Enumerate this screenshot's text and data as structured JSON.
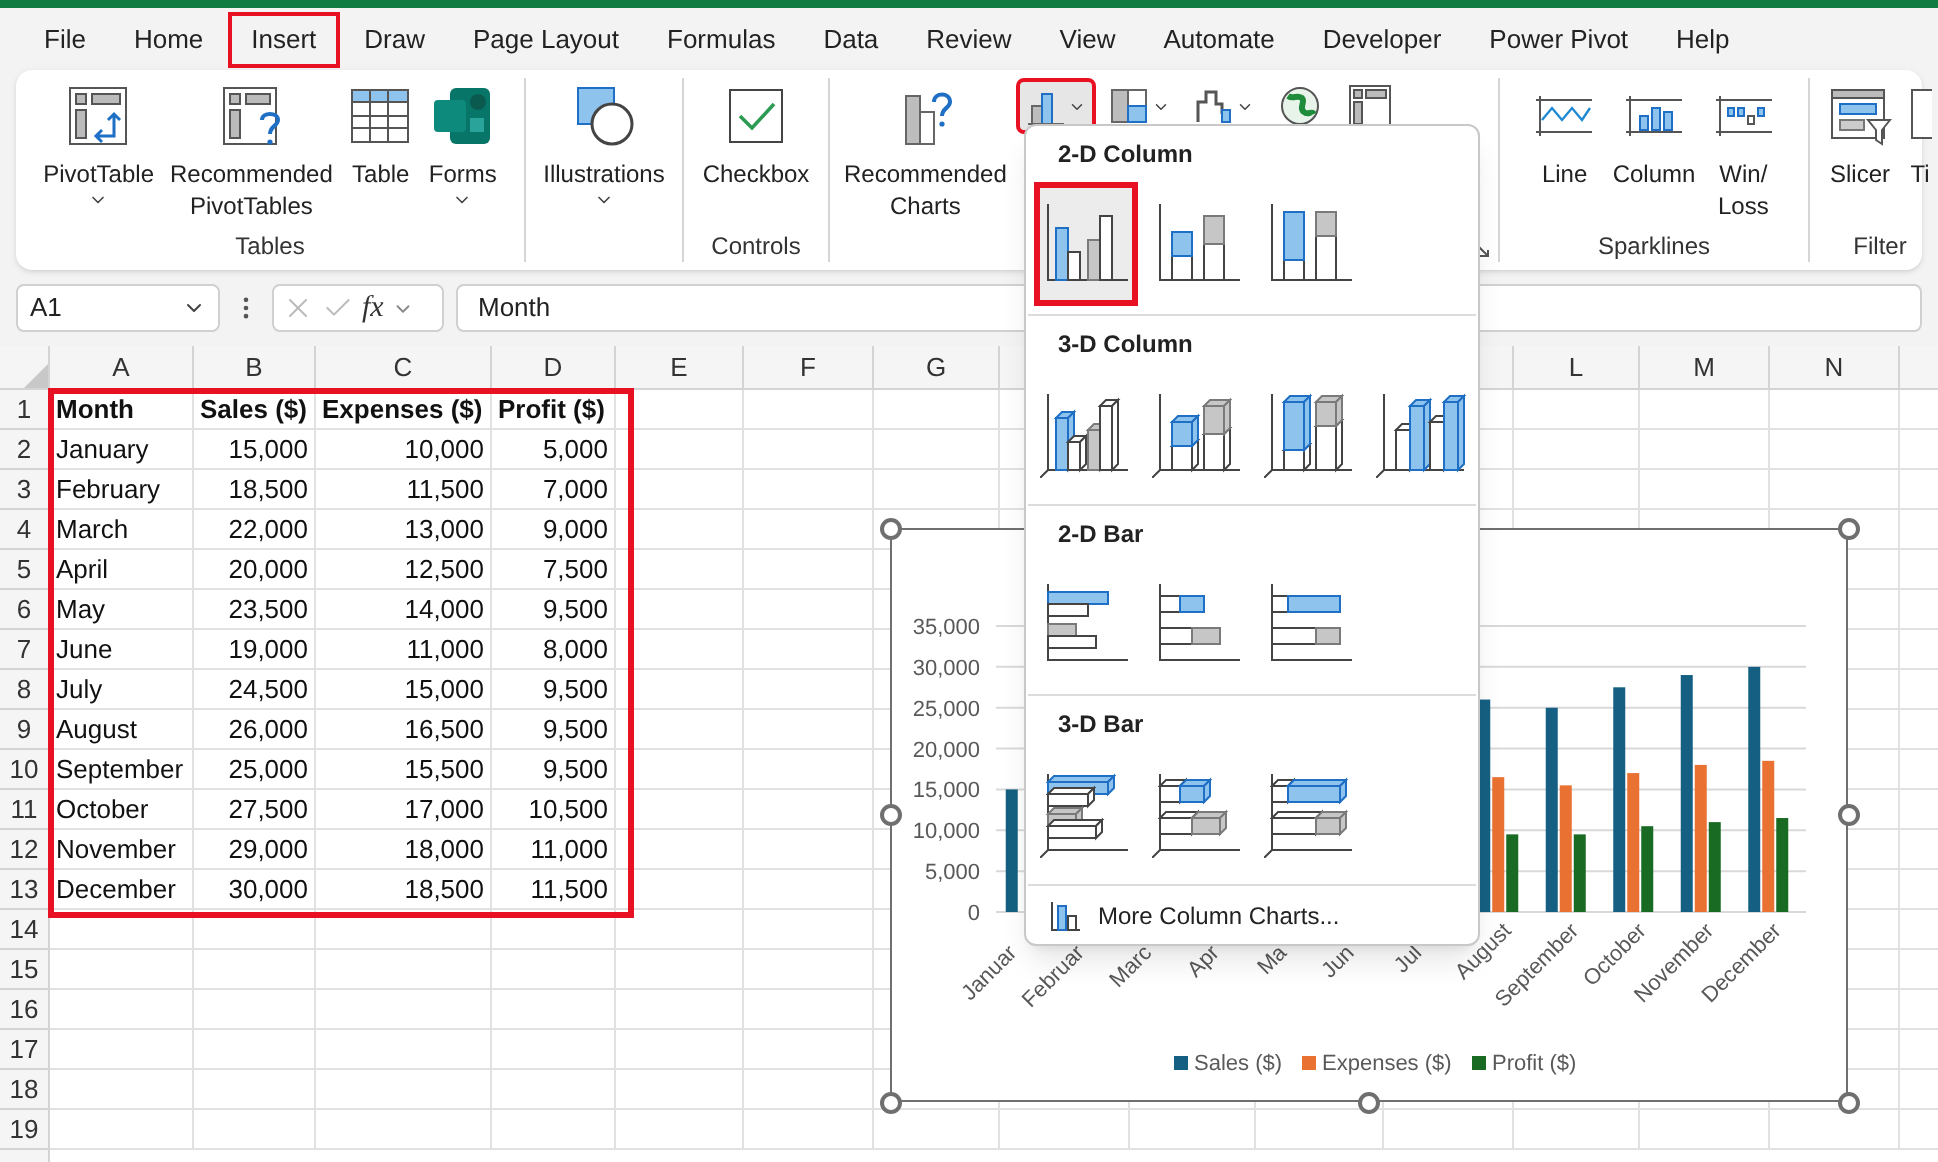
{
  "tabs": [
    {
      "label": "File",
      "highlighted": false
    },
    {
      "label": "Home",
      "highlighted": false
    },
    {
      "label": "Insert",
      "highlighted": true
    },
    {
      "label": "Draw",
      "highlighted": false
    },
    {
      "label": "Page Layout",
      "highlighted": false
    },
    {
      "label": "Formulas",
      "highlighted": false
    },
    {
      "label": "Data",
      "highlighted": false
    },
    {
      "label": "Review",
      "highlighted": false
    },
    {
      "label": "View",
      "highlighted": false
    },
    {
      "label": "Automate",
      "highlighted": false
    },
    {
      "label": "Developer",
      "highlighted": false
    },
    {
      "label": "Power Pivot",
      "highlighted": false
    },
    {
      "label": "Help",
      "highlighted": false
    }
  ],
  "ribbon": {
    "groups": [
      {
        "label": "Tables",
        "items": [
          {
            "kind": "large",
            "lines": [
              "PivotTable"
            ],
            "caret": true
          },
          {
            "kind": "large",
            "lines": [
              "Recommended",
              "PivotTables"
            ],
            "caret": false
          },
          {
            "kind": "large",
            "lines": [
              "Table"
            ],
            "caret": false
          },
          {
            "kind": "large",
            "lines": [
              "Forms"
            ],
            "caret": true
          }
        ]
      },
      {
        "items": [
          {
            "kind": "large",
            "lines": [
              "Illustrations"
            ],
            "caret": true
          }
        ]
      },
      {
        "label": "Controls",
        "items": [
          {
            "kind": "large",
            "lines": [
              "Checkbox"
            ],
            "caret": false
          }
        ]
      },
      {
        "launcher": true,
        "items": [
          {
            "kind": "large",
            "lines": [
              "Recommended",
              "Charts"
            ],
            "caret": false
          },
          {
            "kind": "small",
            "caret": true,
            "highlighted": true
          },
          {
            "kind": "small",
            "caret": true,
            "highlighted": false
          },
          {
            "kind": "small",
            "caret": true,
            "highlighted": false
          },
          {
            "kind": "small",
            "caret": false,
            "highlighted": false
          },
          {
            "kind": "small",
            "caret": false,
            "highlighted": false
          }
        ]
      },
      {
        "label": "Sparklines",
        "items": [
          {
            "kind": "large",
            "lines": [
              "Line"
            ],
            "caret": false
          },
          {
            "kind": "large",
            "lines": [
              "Column"
            ],
            "caret": false
          },
          {
            "kind": "large",
            "lines": [
              "Win/",
              "Loss"
            ],
            "caret": false
          }
        ]
      },
      {
        "label": "Filter",
        "items": [
          {
            "kind": "large",
            "lines": [
              "Slicer"
            ],
            "caret": false
          },
          {
            "kind": "large",
            "lines": [
              "Ti"
            ],
            "caret": false
          }
        ]
      }
    ]
  },
  "formula_bar": {
    "name_box": "A1",
    "function_label": "fx",
    "value": "Month"
  },
  "sheet": {
    "columns": [
      "A",
      "B",
      "C",
      "D",
      "E",
      "F",
      "G",
      "L",
      "M",
      "N"
    ],
    "rows": [
      "1",
      "2",
      "3",
      "4",
      "5",
      "6",
      "7",
      "8",
      "9",
      "10",
      "11",
      "12",
      "13",
      "14",
      "15",
      "16",
      "17",
      "18",
      "19"
    ]
  },
  "table": {
    "highlighted": true,
    "header": [
      "Month",
      "Sales ($)",
      "Expenses ($)",
      "Profit ($)"
    ],
    "rows": [
      [
        "January",
        "15,000",
        "10,000",
        "5,000"
      ],
      [
        "February",
        "18,500",
        "11,500",
        "7,000"
      ],
      [
        "March",
        "22,000",
        "13,000",
        "9,000"
      ],
      [
        "April",
        "20,000",
        "12,500",
        "7,500"
      ],
      [
        "May",
        "23,500",
        "14,000",
        "9,500"
      ],
      [
        "June",
        "19,000",
        "11,000",
        "8,000"
      ],
      [
        "July",
        "24,500",
        "15,000",
        "9,500"
      ],
      [
        "August",
        "26,000",
        "16,500",
        "9,500"
      ],
      [
        "September",
        "25,000",
        "15,500",
        "9,500"
      ],
      [
        "October",
        "27,500",
        "17,000",
        "10,500"
      ],
      [
        "November",
        "29,000",
        "18,000",
        "11,000"
      ],
      [
        "December",
        "30,000",
        "18,500",
        "11,500"
      ]
    ]
  },
  "chart": {
    "chart_data": {
      "type": "bar",
      "categories": [
        "Januar",
        "Februar",
        "Marc",
        "Apr",
        "Ma",
        "Jun",
        "Jul",
        "August",
        "September",
        "October",
        "November",
        "December"
      ],
      "series": [
        {
          "name": "Sales ($)",
          "color": "#156082",
          "values": [
            15000,
            null,
            null,
            null,
            null,
            null,
            null,
            26000,
            25000,
            27500,
            29000,
            30000
          ]
        },
        {
          "name": "Expenses ($)",
          "color": "#e97132",
          "values": [
            null,
            null,
            null,
            null,
            null,
            null,
            null,
            16500,
            15500,
            17000,
            18000,
            18500
          ]
        },
        {
          "name": "Profit ($)",
          "color": "#196b24",
          "values": [
            null,
            null,
            null,
            null,
            null,
            null,
            null,
            9500,
            9500,
            10500,
            11000,
            11500
          ]
        }
      ],
      "grid": true,
      "legend": "bottom",
      "ylim": [
        0,
        35000
      ],
      "yticks": [
        {
          "value": 0,
          "label": "0"
        },
        {
          "value": 5000,
          "label": "5,000"
        },
        {
          "value": 10000,
          "label": "10,000"
        },
        {
          "value": 15000,
          "label": "15,000"
        },
        {
          "value": 20000,
          "label": "20,000"
        },
        {
          "value": 25000,
          "label": "25,000"
        },
        {
          "value": 30000,
          "label": "30,000"
        },
        {
          "value": 35000,
          "label": "35,000"
        }
      ]
    }
  },
  "dropdown": {
    "sections": [
      {
        "title": "2-D Column",
        "kind": "column2d",
        "options": [
          {
            "selected": true,
            "highlighted": true
          },
          {
            "selected": false,
            "highlighted": false
          },
          {
            "selected": false,
            "highlighted": false
          }
        ]
      },
      {
        "title": "3-D Column",
        "kind": "column3d",
        "options": [
          {
            "selected": false,
            "highlighted": false
          },
          {
            "selected": false,
            "highlighted": false
          },
          {
            "selected": false,
            "highlighted": false
          },
          {
            "selected": false,
            "highlighted": false
          }
        ]
      },
      {
        "title": "2-D Bar",
        "kind": "bar2d",
        "options": [
          {
            "selected": false,
            "highlighted": false
          },
          {
            "selected": false,
            "highlighted": false
          },
          {
            "selected": false,
            "highlighted": false
          }
        ]
      },
      {
        "title": "3-D Bar",
        "kind": "bar3d",
        "options": [
          {
            "selected": false,
            "highlighted": false
          },
          {
            "selected": false,
            "highlighted": false
          },
          {
            "selected": false,
            "highlighted": false
          }
        ]
      }
    ],
    "footer": "More Column Charts..."
  }
}
